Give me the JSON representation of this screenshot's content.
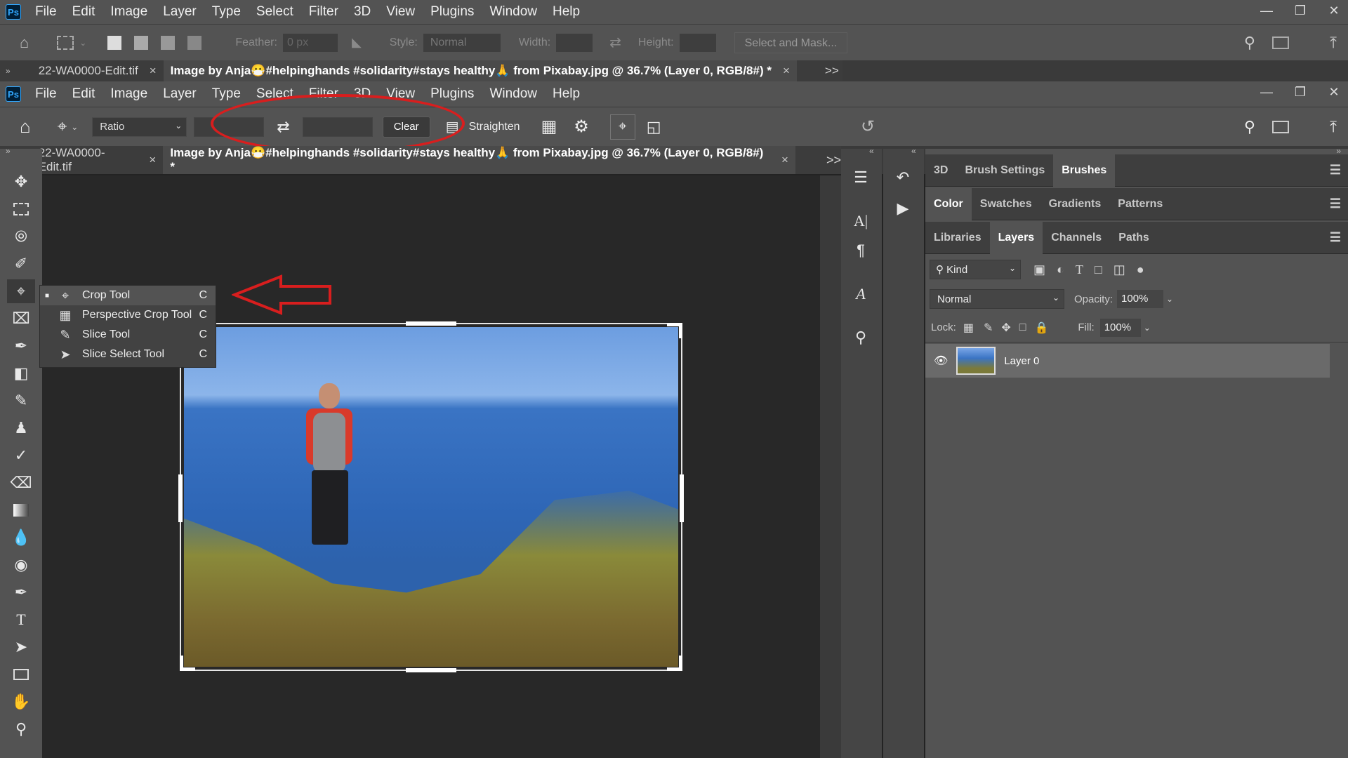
{
  "top_menu": {
    "items": [
      "File",
      "Edit",
      "Image",
      "Layer",
      "Type",
      "Select",
      "Filter",
      "3D",
      "View",
      "Plugins",
      "Window",
      "Help"
    ],
    "logo": "Ps"
  },
  "ghost_options": {
    "feather_label": "Feather:",
    "feather_value": "0 px",
    "style_label": "Style:",
    "style_value": "Normal",
    "width_label": "Width:",
    "height_label": "Height:",
    "select_mask": "Select and Mask..."
  },
  "doc_tabs": {
    "tab1": "22-WA0000-Edit.tif",
    "tab2": "Image by Anja😷#helpinghands #solidarity#stays healthy🙏 from Pixabay.jpg @ 36.7% (Layer 0, RGB/8#) *",
    "close": "×",
    "overflow": ">>"
  },
  "crop_options": {
    "ratio": "Ratio",
    "clear": "Clear",
    "straighten": "Straighten"
  },
  "flyout": [
    {
      "label": "Crop Tool",
      "key": "C",
      "icon": "crop-icon",
      "selected": true
    },
    {
      "label": "Perspective Crop Tool",
      "key": "C",
      "icon": "perspective-crop-icon",
      "selected": false
    },
    {
      "label": "Slice Tool",
      "key": "C",
      "icon": "slice-icon",
      "selected": false
    },
    {
      "label": "Slice Select Tool",
      "key": "C",
      "icon": "slice-select-icon",
      "selected": false
    }
  ],
  "panel_groups": {
    "row1": [
      "3D",
      "Brush Settings",
      "Brushes"
    ],
    "row2": [
      "Color",
      "Swatches",
      "Gradients",
      "Patterns"
    ],
    "row3": [
      "Libraries",
      "Layers",
      "Channels",
      "Paths"
    ]
  },
  "layers": {
    "filter_kind": "Kind",
    "blend_mode": "Normal",
    "opacity_label": "Opacity:",
    "opacity_value": "100%",
    "lock_label": "Lock:",
    "fill_label": "Fill:",
    "fill_value": "100%",
    "layer_name": "Layer 0"
  },
  "colors": {
    "accent_red": "#d81e1e",
    "panel": "#535353",
    "bg": "#282828"
  }
}
